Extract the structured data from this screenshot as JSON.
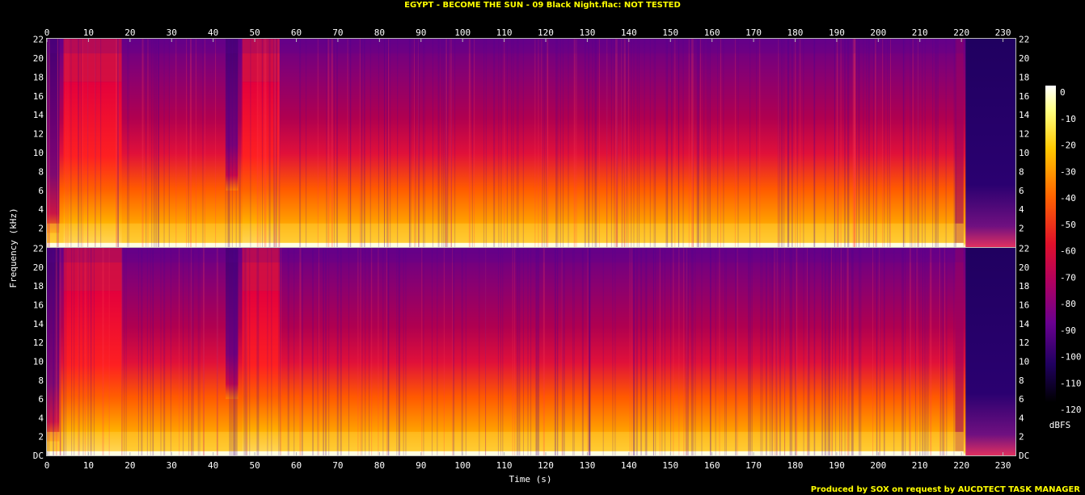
{
  "chart_data": {
    "type": "heatmap",
    "title": "EGYPT - BECOME THE SUN - 09 Black Night.flac: NOT TESTED",
    "xlabel": "Time (s)",
    "ylabel": "Frequency (kHz)",
    "xlim": [
      0,
      233
    ],
    "ylim": [
      0,
      22.05
    ],
    "x_ticks": [
      "0",
      "10",
      "20",
      "30",
      "40",
      "50",
      "60",
      "70",
      "80",
      "90",
      "100",
      "110",
      "120",
      "130",
      "140",
      "150",
      "160",
      "170",
      "180",
      "190",
      "200",
      "210",
      "220",
      "230"
    ],
    "y_ticks": [
      "DC",
      "2",
      "4",
      "6",
      "8",
      "10",
      "12",
      "14",
      "16",
      "18",
      "20",
      "22"
    ],
    "colorbar": {
      "label": "dBFS",
      "ticks": [
        "0",
        "-10",
        "-20",
        "-30",
        "-40",
        "-50",
        "-60",
        "-70",
        "-80",
        "-90",
        "-100",
        "-110",
        "-120"
      ],
      "range": [
        -120,
        0
      ]
    },
    "channels": [
      {
        "name": "",
        "content_ends_s": 220.5,
        "lowpass_khz": 20.5
      },
      {
        "name": "",
        "content_ends_s": 220.5,
        "lowpass_khz": 20.5
      }
    ],
    "loud_regions": [
      {
        "from_s": 4,
        "to_s": 18,
        "level_db": -55
      },
      {
        "from_s": 47,
        "to_s": 56,
        "level_db": -55
      }
    ],
    "quiet_regions": [
      {
        "from_s": 43,
        "to_s": 46,
        "level_db": -90
      },
      {
        "from_s": 0,
        "to_s": 3,
        "level_db": -95
      },
      {
        "from_s": 221,
        "to_s": 233,
        "level_db": -110
      }
    ],
    "credit": "Produced by SOX on request by AUCDTECT TASK MANAGER"
  }
}
